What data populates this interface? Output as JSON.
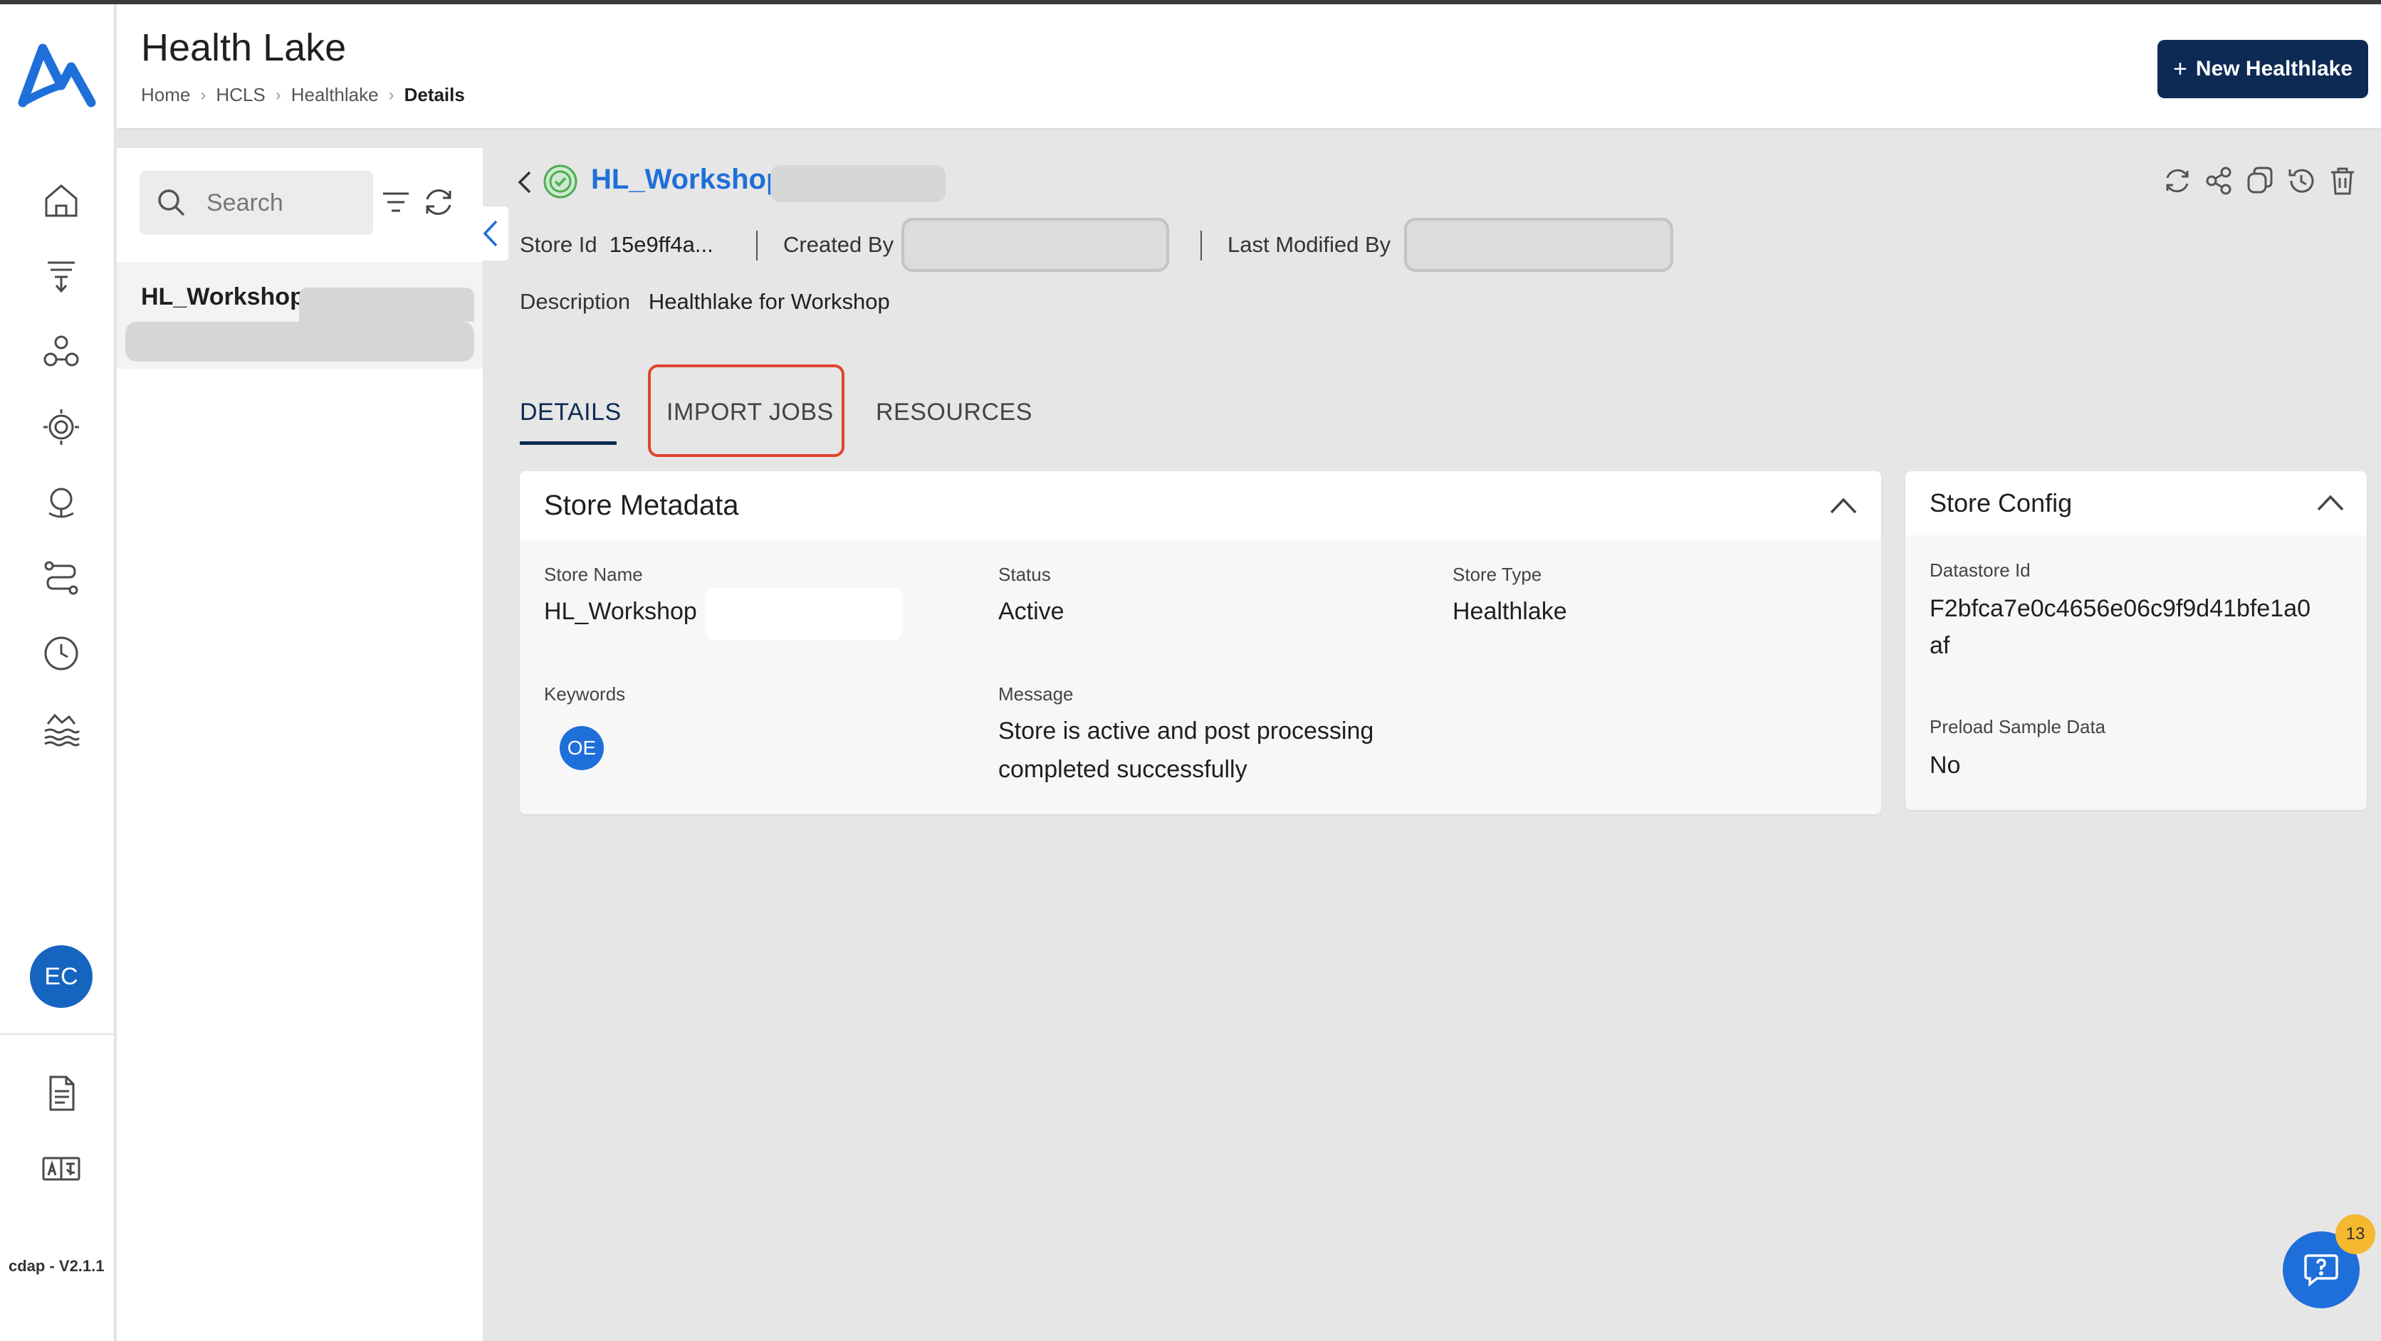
{
  "app": {
    "version": "cdap - V2.1.1",
    "user_initials": "EC"
  },
  "header": {
    "title": "Health Lake",
    "breadcrumb": [
      "Home",
      "HCLS",
      "Healthlake",
      "Details"
    ],
    "new_button_label": "New Healthlake"
  },
  "nav": {
    "items": [
      "home-icon",
      "funnel-icon",
      "users-group-icon",
      "settings-cycle-icon",
      "globe-stand-icon",
      "pipeline-icon",
      "clock-icon",
      "lake-waves-icon"
    ],
    "bottom": [
      "document-icon",
      "translate-icon"
    ]
  },
  "list": {
    "search_placeholder": "Search",
    "items": [
      {
        "name": "HL_Workshop"
      }
    ]
  },
  "detail": {
    "name": "HL_Workshop",
    "store_id_label": "Store Id",
    "store_id": "15e9ff4a...",
    "created_by_label": "Created By",
    "last_modified_label": "Last Modified By",
    "description_label": "Description",
    "description": "Healthlake for Workshop",
    "tabs": [
      "DETAILS",
      "IMPORT JOBS",
      "RESOURCES"
    ],
    "active_tab": "DETAILS"
  },
  "metadata": {
    "title": "Store Metadata",
    "store_name_label": "Store Name",
    "store_name": "HL_Workshop",
    "status_label": "Status",
    "status": "Active",
    "store_type_label": "Store Type",
    "store_type": "Healthlake",
    "keywords_label": "Keywords",
    "keyword_badge": "OE",
    "message_label": "Message",
    "message_line1": "Store is active and post processing",
    "message_line2": "completed successfully"
  },
  "config": {
    "title": "Store Config",
    "datastore_id_label": "Datastore Id",
    "datastore_id_line1": "F2bfca7e0c4656e06c9f9d41bfe1a0",
    "datastore_id_line2": "af",
    "preload_label": "Preload Sample Data",
    "preload": "No"
  },
  "help": {
    "badge_count": "13"
  },
  "colors": {
    "primary": "#0d2a55",
    "accent": "#1e6fd9",
    "highlight": "#e0442e",
    "status_ok": "#4caf50"
  }
}
